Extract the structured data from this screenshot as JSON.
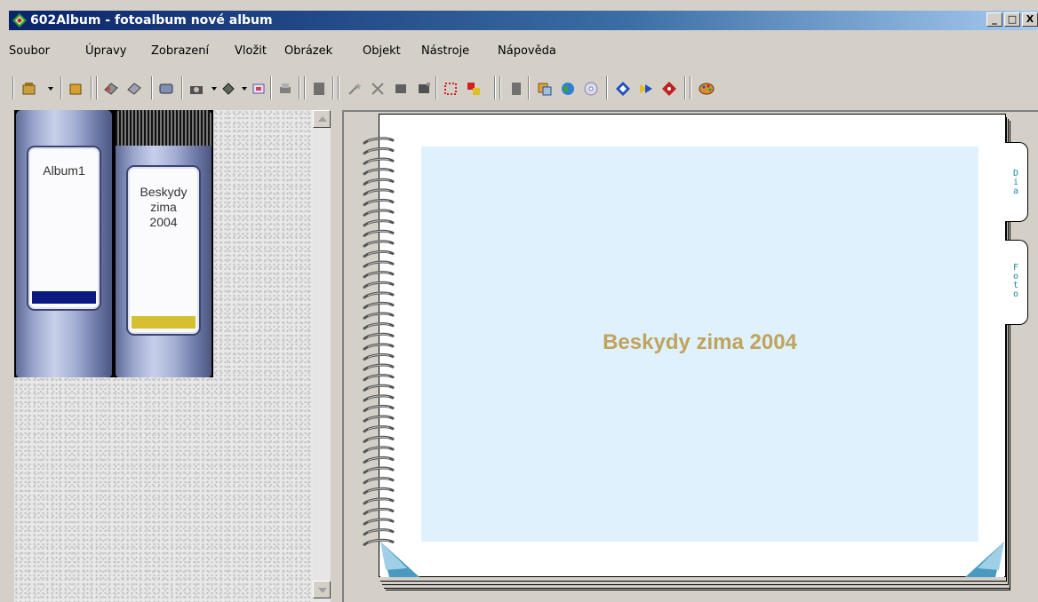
{
  "window": {
    "title": "602Album - fotoalbum nové album",
    "buttons": {
      "minimize": "_",
      "maximize": "□",
      "close": "X"
    }
  },
  "menu": {
    "items": [
      "Soubor",
      "Úpravy",
      "Zobrazení",
      "Vložit",
      "Obrázek",
      "Objekt",
      "Nástroje",
      "Nápověda"
    ]
  },
  "toolbar": {
    "icons": [
      "album-box-icon",
      "album-open-icon",
      "photos-icon",
      "photos-edit-icon",
      "scanner-icon",
      "camera-icon",
      "disk-icon",
      "frame-icon",
      "print-icon",
      "page-icon",
      "magic-wand-icon",
      "effects-icon",
      "layout-icon",
      "layout2-icon",
      "select-icon",
      "crop-icon",
      "page2-icon",
      "export-icon",
      "web-icon",
      "cd-icon",
      "navigate-icon",
      "forward-icon",
      "diamond-icon",
      "palette-icon"
    ]
  },
  "shelf": {
    "albums": [
      {
        "label": "Album1",
        "band_color": "#0a1a80"
      },
      {
        "label": "Beskydy\nzima\n2004",
        "band_color": "#d4c030"
      }
    ]
  },
  "album_page": {
    "title": "Beskydy zima 2004",
    "tabs": [
      "Dia",
      "Foto"
    ],
    "background": "#def1fd",
    "title_color": "#c0a35c"
  }
}
